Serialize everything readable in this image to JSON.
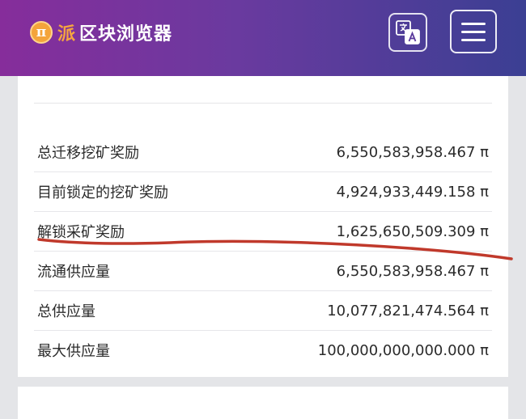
{
  "header": {
    "logo_symbol": "π",
    "brand": "派",
    "title": "区块浏览器",
    "accent_color": "#f5a53f",
    "icons": {
      "language": "translate-icon",
      "menu": "hamburger-menu-icon"
    }
  },
  "stats": [
    {
      "label": "总迁移挖矿奖励",
      "value": "6,550,583,958.467 π"
    },
    {
      "label": "目前锁定的挖矿奖励",
      "value": "4,924,933,449.158 π"
    },
    {
      "label": "解锁采矿奖励",
      "value": "1,625,650,509.309 π"
    },
    {
      "label": "流通供应量",
      "value": "6,550,583,958.467 π"
    },
    {
      "label": "总供应量",
      "value": "10,077,821,474.564 π"
    },
    {
      "label": "最大供应量",
      "value": "100,000,000,000.000 π"
    }
  ],
  "annotation_color": "#c0392b"
}
